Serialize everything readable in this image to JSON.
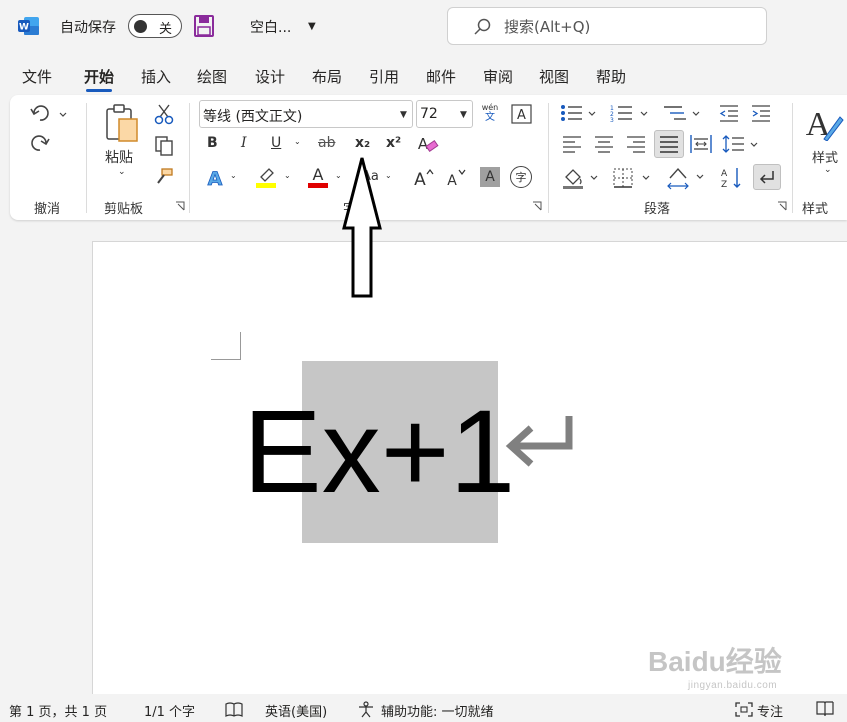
{
  "titlebar": {
    "autosave_label": "自动保存",
    "toggle_state": "关",
    "doc_title": "空白...",
    "search_placeholder": "搜索(Alt+Q)"
  },
  "tabs": [
    "文件",
    "开始",
    "插入",
    "绘图",
    "设计",
    "布局",
    "引用",
    "邮件",
    "审阅",
    "视图",
    "帮助"
  ],
  "active_tab": "开始",
  "ribbon": {
    "undo_group_label": "撤消",
    "paste_label": "粘贴",
    "clipboard_group_label": "剪贴板",
    "font_name": "等线 (西文正文)",
    "font_size": "72",
    "font_group_label": "字体",
    "phonetic_top": "wén",
    "phonetic_bottom": "文",
    "bold": "B",
    "italic": "I",
    "underline": "U",
    "strike": "ab",
    "subscript": "x₂",
    "superscript": "x²",
    "text_effect": "A",
    "font_color": "A",
    "change_case": "Aa",
    "grow_font": "A^",
    "shrink_font": "Aˇ",
    "char_shade": "A",
    "enclose": "字",
    "paragraph_group_label": "段落",
    "styles_label": "样式",
    "styles_group_label": "样式"
  },
  "document": {
    "text": "Ex+1",
    "selected_text": "x+1"
  },
  "statusbar": {
    "page": "第 1 页，共 1 页",
    "words": "1/1 个字",
    "language": "英语(美国)",
    "accessibility": "辅助功能: 一切就绪",
    "focus": "专注"
  },
  "watermark": {
    "brand": "Baidu经验",
    "url": "jingyan.baidu.com"
  },
  "colors": {
    "accent": "#185abd",
    "highlight": "#ffff00",
    "font_color": "#e00000",
    "selection": "#c6c6c6",
    "word_blue": "#185abd",
    "save_purple": "#8a2b9b"
  }
}
